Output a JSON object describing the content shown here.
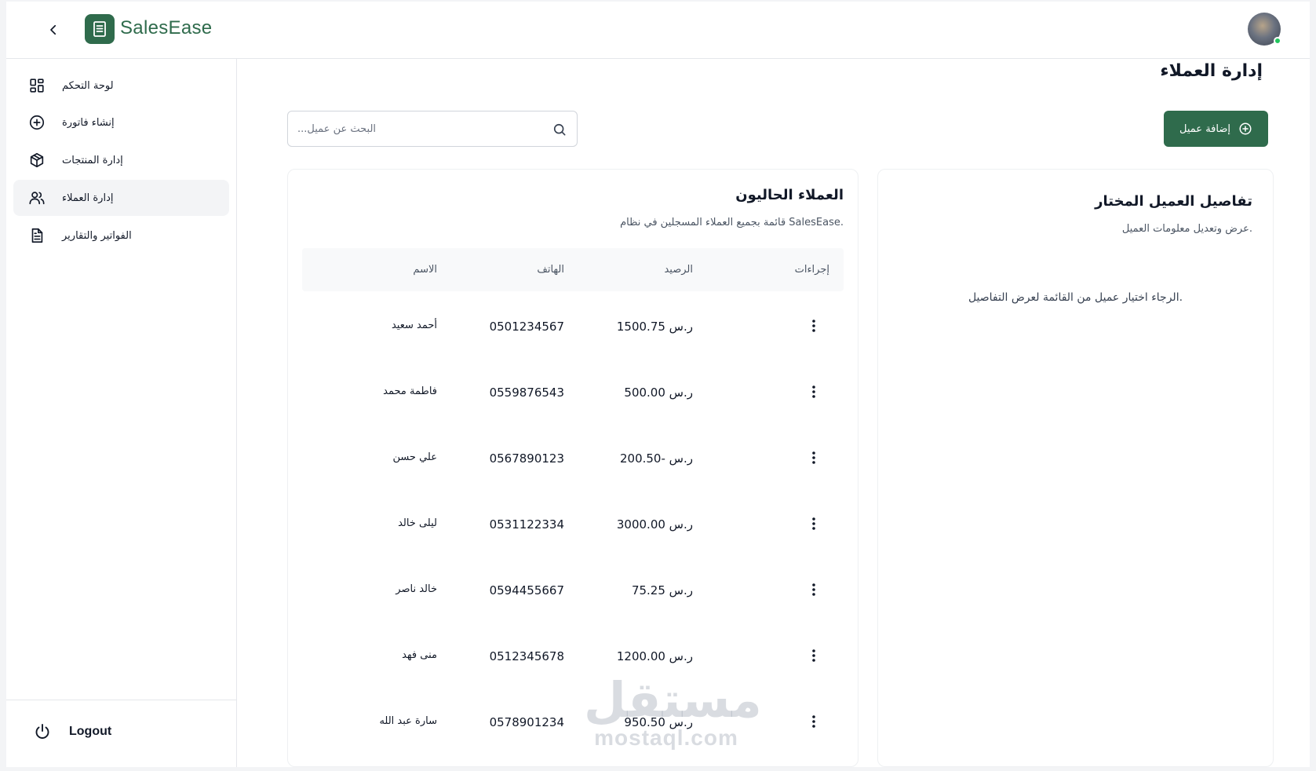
{
  "app": {
    "brand": "SalesEase",
    "accent": "#2f6b4c"
  },
  "sidebar": {
    "items": [
      {
        "label": "لوحة التحكم",
        "icon": "dashboard-icon"
      },
      {
        "label": "إنشاء فاتورة",
        "icon": "plus-circle-icon"
      },
      {
        "label": "إدارة المنتجات",
        "icon": "box-icon"
      },
      {
        "label": "إدارة العملاء",
        "icon": "users-icon",
        "active": true
      },
      {
        "label": "الفواتير والتقارير",
        "icon": "file-text-icon"
      }
    ],
    "logout_label": "Logout"
  },
  "main": {
    "title": "إدارة العملاء",
    "add_button_label": "إضافة عميل",
    "search_placeholder": "...البحث عن عميل"
  },
  "customers_card": {
    "title": "العملاء الحاليون",
    "subtitle": ".SalesEase قائمة بجميع العملاء المسجلين في نظام",
    "headers": {
      "name": "الاسم",
      "phone": "الهاتف",
      "balance": "الرصيد",
      "actions": "إجراءات"
    },
    "rows": [
      {
        "name": "أحمد سعيد",
        "phone": "0501234567",
        "balance": "ر.س 1500.75"
      },
      {
        "name": "فاطمة محمد",
        "phone": "0559876543",
        "balance": "ر.س 500.00"
      },
      {
        "name": "علي حسن",
        "phone": "0567890123",
        "balance": "ر.س -200.50"
      },
      {
        "name": "ليلى خالد",
        "phone": "0531122334",
        "balance": "ر.س 3000.00"
      },
      {
        "name": "خالد ناصر",
        "phone": "0594455667",
        "balance": "ر.س 75.25"
      },
      {
        "name": "منى فهد",
        "phone": "0512345678",
        "balance": "ر.س 1200.00"
      },
      {
        "name": "سارة عبد الله",
        "phone": "0578901234",
        "balance": "ر.س 950.50"
      }
    ]
  },
  "details_card": {
    "title": "تفاصيل العميل المختار",
    "subtitle": ".عرض وتعديل معلومات العميل",
    "empty_message": ".الرجاء اختيار عميل من القائمة لعرض التفاصيل"
  },
  "watermark": {
    "arabic": "مستقل",
    "latin": "mostaql.com"
  }
}
